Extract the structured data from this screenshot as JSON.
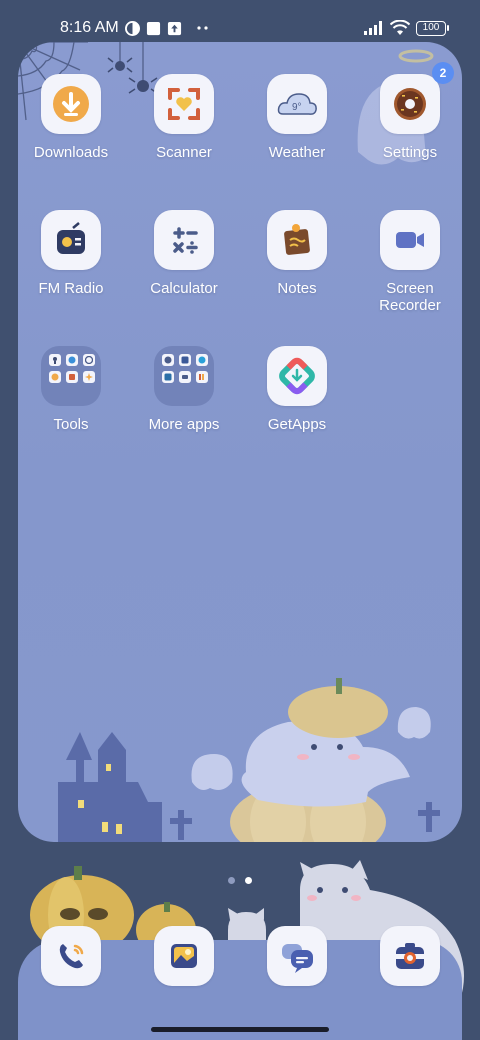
{
  "status_bar": {
    "time": "8:16 AM",
    "battery": "100"
  },
  "apps": [
    {
      "label": "Downloads"
    },
    {
      "label": "Scanner"
    },
    {
      "label": "Weather"
    },
    {
      "label": "Settings",
      "badge": "2"
    },
    {
      "label": "FM Radio"
    },
    {
      "label": "Calculator"
    },
    {
      "label": "Notes"
    },
    {
      "label": "Screen\nRecorder"
    },
    {
      "label": "Tools"
    },
    {
      "label": "More apps"
    },
    {
      "label": "GetApps"
    }
  ],
  "dock": [
    {
      "name": "phone"
    },
    {
      "name": "gallery"
    },
    {
      "name": "messages"
    },
    {
      "name": "camera"
    }
  ],
  "pages": {
    "count": 2,
    "active": 2
  },
  "colors": {
    "background": "#40506f",
    "wallpaper": "#8a9bd0",
    "icon_bg": "#f3f4fb",
    "badge": "#5b8ef2"
  }
}
